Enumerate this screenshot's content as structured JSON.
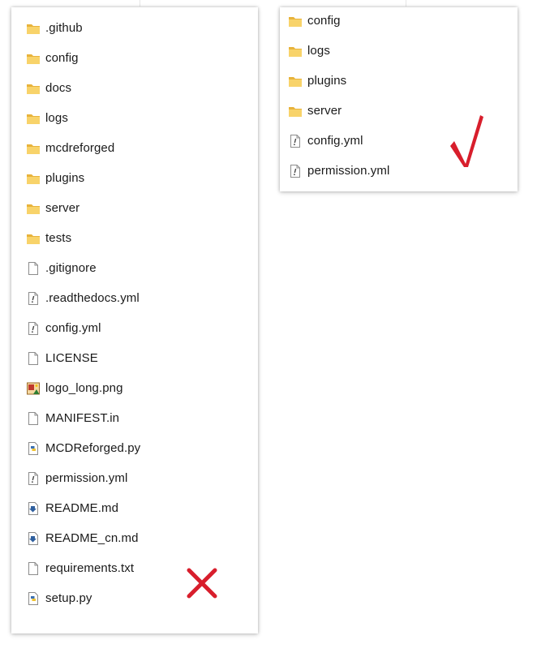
{
  "theme": {
    "folder_color": "#f8d36a",
    "folder_tab_color": "#e8b33b",
    "mark_color": "#d81e2c"
  },
  "left_panel": {
    "items": [
      {
        "name": ".github",
        "icon": "folder-icon"
      },
      {
        "name": "config",
        "icon": "folder-icon"
      },
      {
        "name": "docs",
        "icon": "folder-icon"
      },
      {
        "name": "logs",
        "icon": "folder-icon"
      },
      {
        "name": "mcdreforged",
        "icon": "folder-icon"
      },
      {
        "name": "plugins",
        "icon": "folder-icon"
      },
      {
        "name": "server",
        "icon": "folder-icon"
      },
      {
        "name": "tests",
        "icon": "folder-icon"
      },
      {
        "name": ".gitignore",
        "icon": "file-icon"
      },
      {
        "name": ".readthedocs.yml",
        "icon": "yaml-file-icon"
      },
      {
        "name": "config.yml",
        "icon": "yaml-file-icon"
      },
      {
        "name": "LICENSE",
        "icon": "file-icon"
      },
      {
        "name": "logo_long.png",
        "icon": "image-file-icon"
      },
      {
        "name": "MANIFEST.in",
        "icon": "file-icon"
      },
      {
        "name": "MCDReforged.py",
        "icon": "python-file-icon"
      },
      {
        "name": "permission.yml",
        "icon": "yaml-file-icon"
      },
      {
        "name": "README.md",
        "icon": "markdown-file-icon"
      },
      {
        "name": "README_cn.md",
        "icon": "markdown-file-icon"
      },
      {
        "name": "requirements.txt",
        "icon": "file-icon"
      },
      {
        "name": "setup.py",
        "icon": "python-file-icon"
      }
    ],
    "verdict": {
      "symbol": "✕",
      "icon": "cross-mark-icon"
    }
  },
  "right_panel": {
    "items": [
      {
        "name": "config",
        "icon": "folder-icon"
      },
      {
        "name": "logs",
        "icon": "folder-icon"
      },
      {
        "name": "plugins",
        "icon": "folder-icon"
      },
      {
        "name": "server",
        "icon": "folder-icon"
      },
      {
        "name": "config.yml",
        "icon": "yaml-file-icon"
      },
      {
        "name": "permission.yml",
        "icon": "yaml-file-icon"
      }
    ],
    "verdict": {
      "symbol": "√",
      "icon": "check-mark-icon"
    }
  }
}
